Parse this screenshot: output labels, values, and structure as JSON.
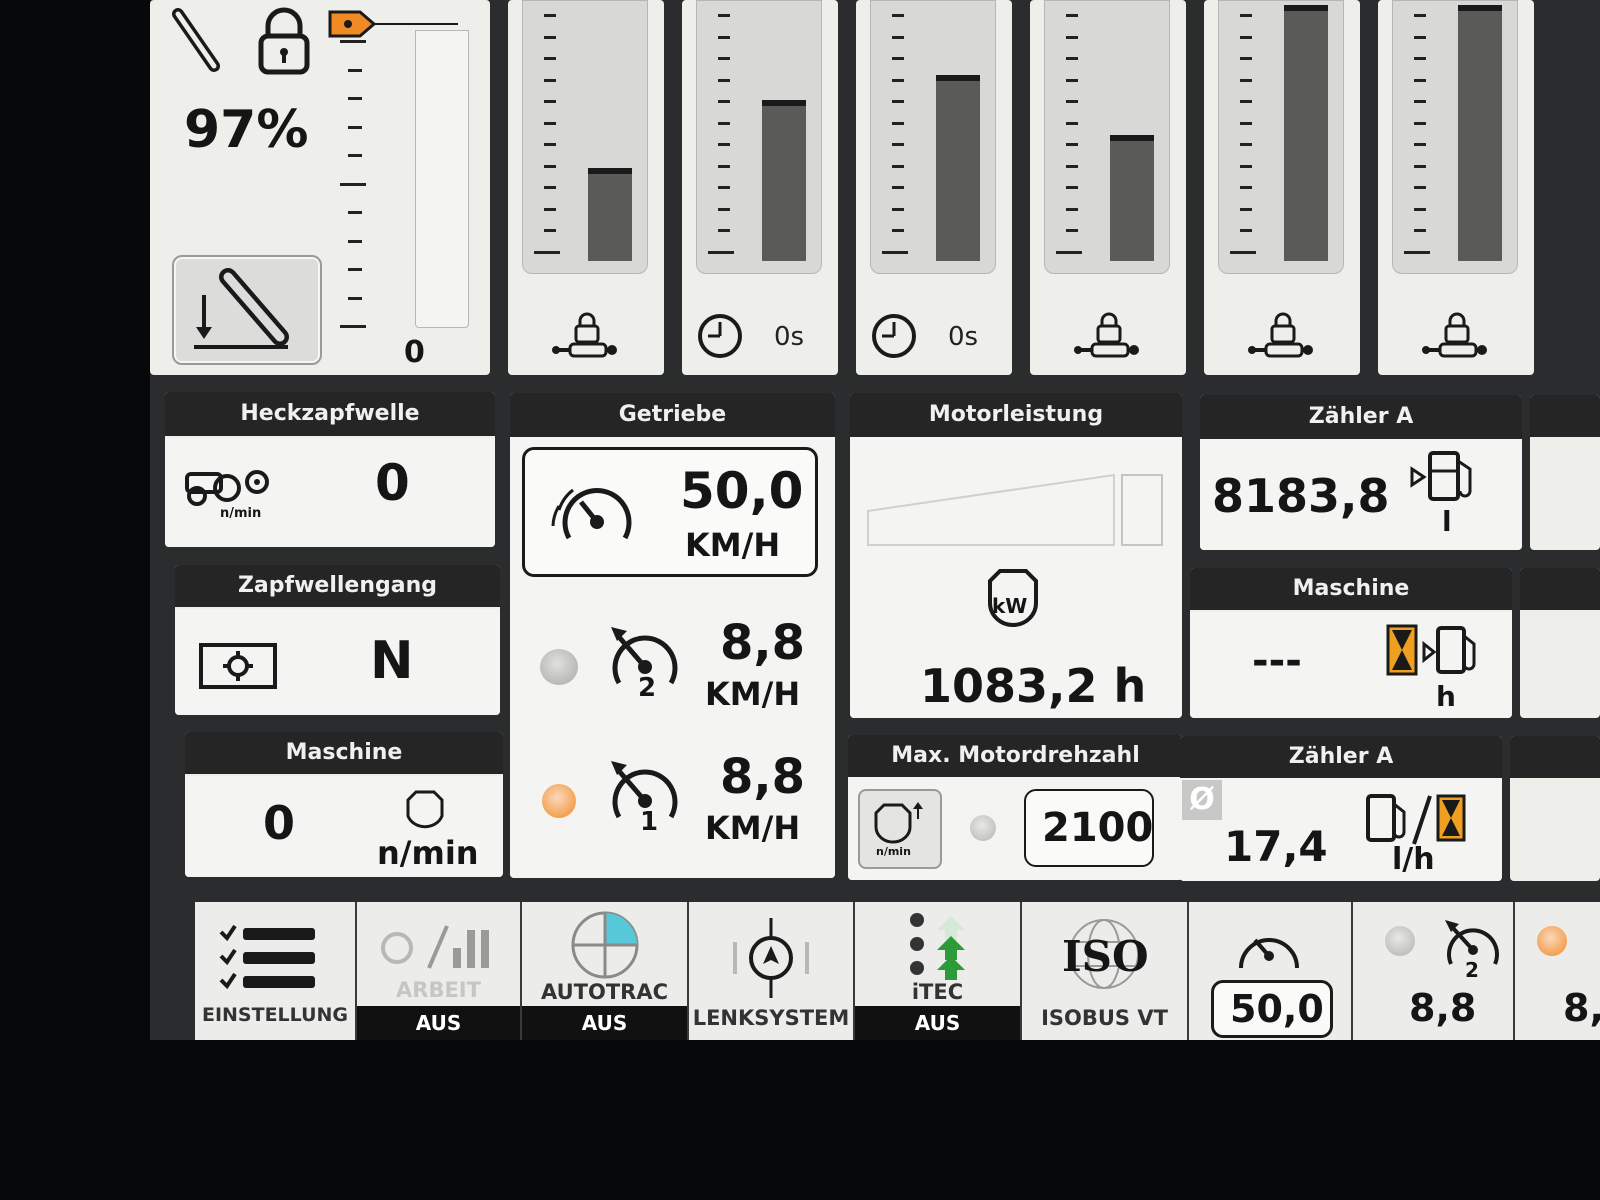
{
  "top": {
    "hitch_percent": "97%",
    "hitch_scale_zero": "0",
    "scv2_time": "0s",
    "scv3_time": "0s"
  },
  "heckzapfwelle": {
    "title": "Heckzapfwelle",
    "value": "0",
    "icon_unit": "n/min"
  },
  "zapfwellengang": {
    "title": "Zapfwellengang",
    "value": "N"
  },
  "maschine_left": {
    "title": "Maschine",
    "value": "0",
    "unit": "n/min"
  },
  "getriebe": {
    "title": "Getriebe",
    "speed_main": "50,0",
    "speed_main_unit": "KM/H",
    "speed2": "8,8",
    "speed2_unit": "KM/H",
    "speed2_index": "2",
    "speed1": "8,8",
    "speed1_unit": "KM/H",
    "speed1_index": "1"
  },
  "motorleistung": {
    "title": "Motorleistung",
    "value": "1083,2 h",
    "icon_label": "kW"
  },
  "max_motordrehzahl": {
    "title": "Max. Motordrehzahl",
    "value": "2100",
    "icon_unit": "n/min"
  },
  "zaehler_a_top": {
    "title": "Zähler A",
    "value": "8183,8",
    "unit": "l"
  },
  "maschine_right": {
    "title": "Maschine",
    "value": "---",
    "unit": "h"
  },
  "zaehler_a_bottom": {
    "title": "Zähler A",
    "value": "17,4",
    "unit": "l/h",
    "avg": "Ø"
  },
  "nav": {
    "einstellung": "EINSTELLUNG",
    "arbeit": "ARBEIT",
    "arbeit_state": "AUS",
    "autotrac": "AUTOTRAC",
    "autotrac_state": "AUS",
    "lenksystem": "LENKSYSTEM",
    "itec": "iTEC",
    "itec_state": "AUS",
    "isobus_logo": "ISO",
    "isobus": "ISOBUS VT",
    "speed_set": "50,0",
    "speed2": "8,8",
    "speed2_index": "2",
    "speed_partial": "8,"
  },
  "scv_levels": [
    0.35,
    0.62,
    0.72,
    0.48,
    1.0,
    1.0
  ],
  "colors": {
    "accent_orange": "#f08a24",
    "header_dark": "#242524",
    "tile_bg": "#f4f4f2",
    "itec_green": "#2e9b3a",
    "autotrac_cyan": "#56c8d8"
  }
}
